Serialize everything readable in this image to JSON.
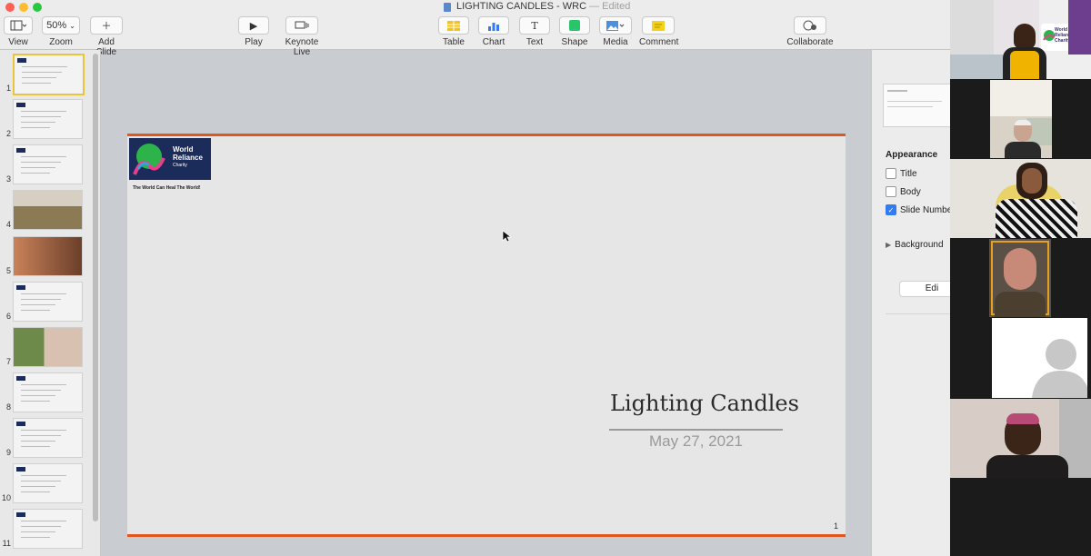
{
  "window": {
    "title": "LIGHTING CANDLES - WRC",
    "status": "— Edited",
    "traffic_colors": [
      "#fe5f57",
      "#febc2e",
      "#28c840"
    ]
  },
  "toolbar": {
    "view": {
      "label": "View",
      "icon": "sidebar-icon"
    },
    "zoom": {
      "label": "Zoom",
      "value": "50%"
    },
    "add_slide": {
      "label": "Add Slide",
      "icon": "plus-icon"
    },
    "play": {
      "label": "Play",
      "icon": "play-icon"
    },
    "keynote_live": {
      "label": "Keynote Live",
      "icon": "broadcast-icon"
    },
    "table": {
      "label": "Table",
      "icon": "table-icon"
    },
    "chart": {
      "label": "Chart",
      "icon": "chart-icon"
    },
    "text": {
      "label": "Text",
      "icon": "text-icon"
    },
    "shape": {
      "label": "Shape",
      "icon": "shape-icon"
    },
    "media": {
      "label": "Media",
      "icon": "media-icon"
    },
    "comment": {
      "label": "Comment",
      "icon": "comment-icon"
    },
    "collaborate": {
      "label": "Collaborate",
      "icon": "collaborate-icon"
    }
  },
  "navigator": {
    "slides": [
      "1",
      "2",
      "3",
      "4",
      "5",
      "6",
      "7",
      "8",
      "9",
      "10",
      "11"
    ],
    "selected": "1"
  },
  "slide": {
    "logo_line1": "World",
    "logo_line2": "Reliance",
    "logo_line3": "Charity",
    "tagline": "The World Can Heal The World!",
    "title": "Lighting Candles",
    "date": "May 27, 2021",
    "number": "1",
    "accent_color": "#e0561f"
  },
  "inspector": {
    "appearance_label": "Appearance",
    "title_label": "Title",
    "body_label": "Body",
    "slide_number_label": "Slide Numbe",
    "background_label": "Background",
    "edit_button": "Edi",
    "checks": {
      "title": false,
      "body": false,
      "slide_number": true
    }
  },
  "video_panel": {
    "top_sign_line1": "World",
    "top_sign_line2": "Reliance",
    "top_sign_line3": "Charity"
  }
}
